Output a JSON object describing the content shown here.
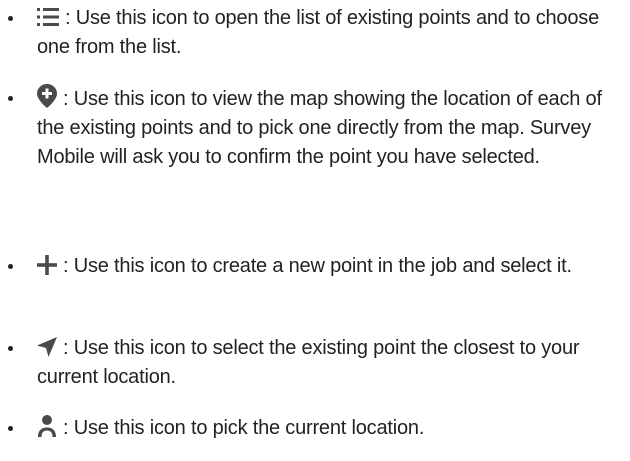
{
  "items": [
    {
      "icon": "list-icon",
      "text": ": Use this icon to open the list of existing points and to choose one from the list."
    },
    {
      "icon": "map-pin-plus-icon",
      "text": ": Use this icon to view the map showing the location of each of the existing points and to pick one directly from the map. Survey Mobile will ask you to confirm the point you have selected."
    },
    {
      "icon": "plus-icon",
      "text": ": Use this icon to create a new point in the job and select it."
    },
    {
      "icon": "navigation-arrow-icon",
      "text": ": Use this icon to select the existing point the closest to your current location."
    },
    {
      "icon": "person-icon",
      "text": ": Use this icon to pick the current location."
    }
  ],
  "colors": {
    "text": "#222222",
    "icon": "#4a4a4a"
  }
}
